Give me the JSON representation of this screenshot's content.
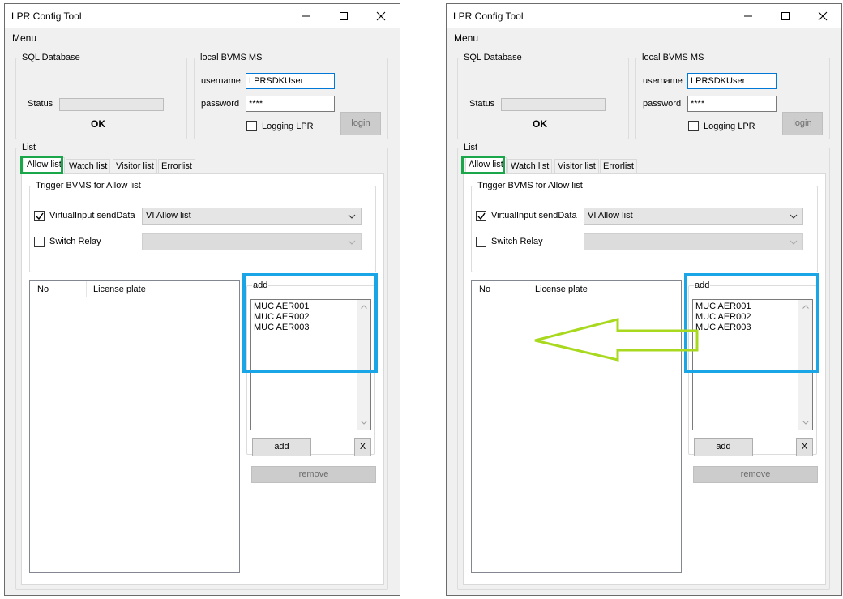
{
  "window": {
    "title": "LPR Config Tool",
    "menu": "Menu"
  },
  "sql": {
    "legend": "SQL Database",
    "status_label": "Status",
    "status_value": "OK"
  },
  "bvms": {
    "legend": "local BVMS MS",
    "username_label": "username",
    "username_value": "LPRSDKUser",
    "password_label": "password",
    "password_value": "****",
    "logging_label": "Logging LPR",
    "login_button": "login"
  },
  "list": {
    "legend": "List",
    "tabs": [
      "Allow list",
      "Watch list",
      "Visitor list",
      "Errorlist"
    ],
    "trigger_legend": "Trigger BVMS for Allow list",
    "virtual_input_label": "VirtualInput sendData",
    "virtual_input_checked": true,
    "virtual_input_option": "VI Allow list",
    "switch_relay_label": "Switch Relay",
    "switch_relay_checked": false,
    "columns": [
      "No",
      "License plate"
    ],
    "add_legend": "add",
    "add_entries": [
      "MUC AER001",
      "MUC AER002",
      "MUC AER003"
    ],
    "add_button": "add",
    "clear_button": "X",
    "remove_button": "remove"
  },
  "colors": {
    "tab_highlight": "#1aa74a",
    "add_box_highlight": "#1aa5e6",
    "arrow": "#a8d91f"
  }
}
